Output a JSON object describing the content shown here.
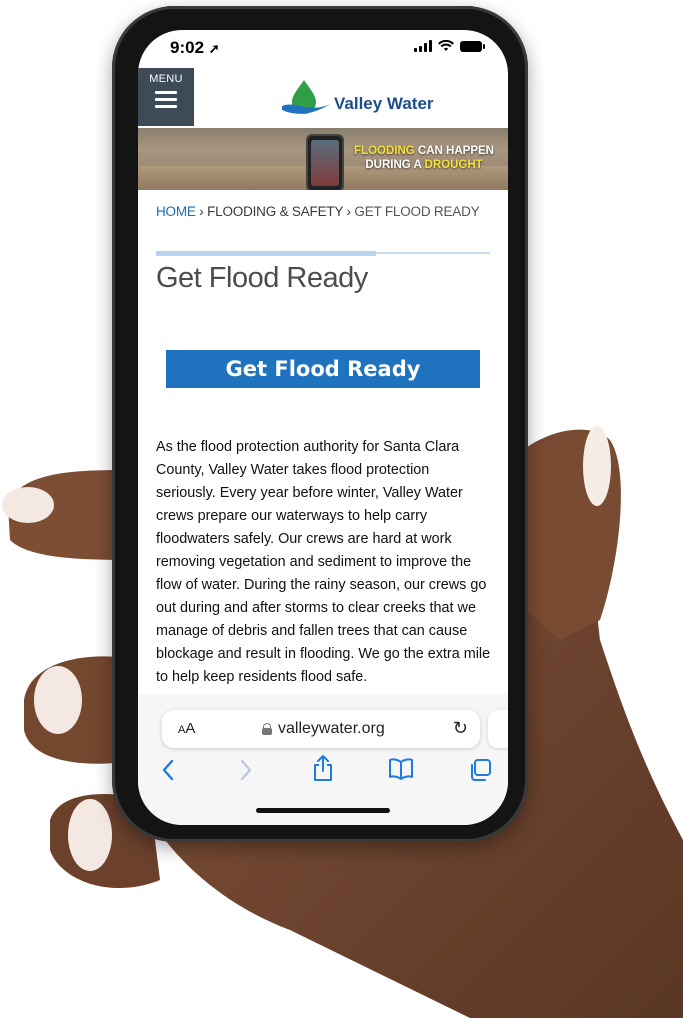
{
  "status_bar": {
    "time": "9:02"
  },
  "header": {
    "menu_label": "MENU",
    "logo_text": "Valley Water"
  },
  "banner": {
    "line1_highlight": "FLOODING",
    "line1_rest": " CAN HAPPEN",
    "line2_rest": "DURING A ",
    "line2_highlight": "DROUGHT"
  },
  "breadcrumb": {
    "home": "HOME",
    "sep": " › ",
    "section": "FLOODING & SAFETY",
    "current": "GET FLOOD READY"
  },
  "page": {
    "title": "Get Flood Ready",
    "cta_label": "Get Flood Ready",
    "body": "As the flood protection authority for Santa Clara County, Valley Water takes flood protection seriously. Every year before winter, Valley Water crews prepare our waterways to help carry floodwaters safely. Our crews are hard at work removing vegetation and sediment to improve the flow of water. During the rainy season, our crews go out during and after storms to clear creeks that we manage of debris and fallen trees that can cause blockage and result in flooding. We go the extra mile to help keep residents flood safe."
  },
  "browser": {
    "aa_small": "A",
    "aa_large": "A",
    "url": "valleywater.org"
  },
  "colors": {
    "brand_blue": "#1f72bd",
    "menu_bg": "#3d4a57",
    "link_blue": "#1b6fb5",
    "ios_blue": "#1d7be3"
  },
  "icons": [
    "navigation-arrow-icon",
    "signal-icon",
    "wifi-icon",
    "battery-icon",
    "hamburger-icon",
    "lock-icon",
    "reload-icon",
    "back-icon",
    "forward-icon",
    "share-icon",
    "bookmarks-icon",
    "tabs-icon"
  ]
}
